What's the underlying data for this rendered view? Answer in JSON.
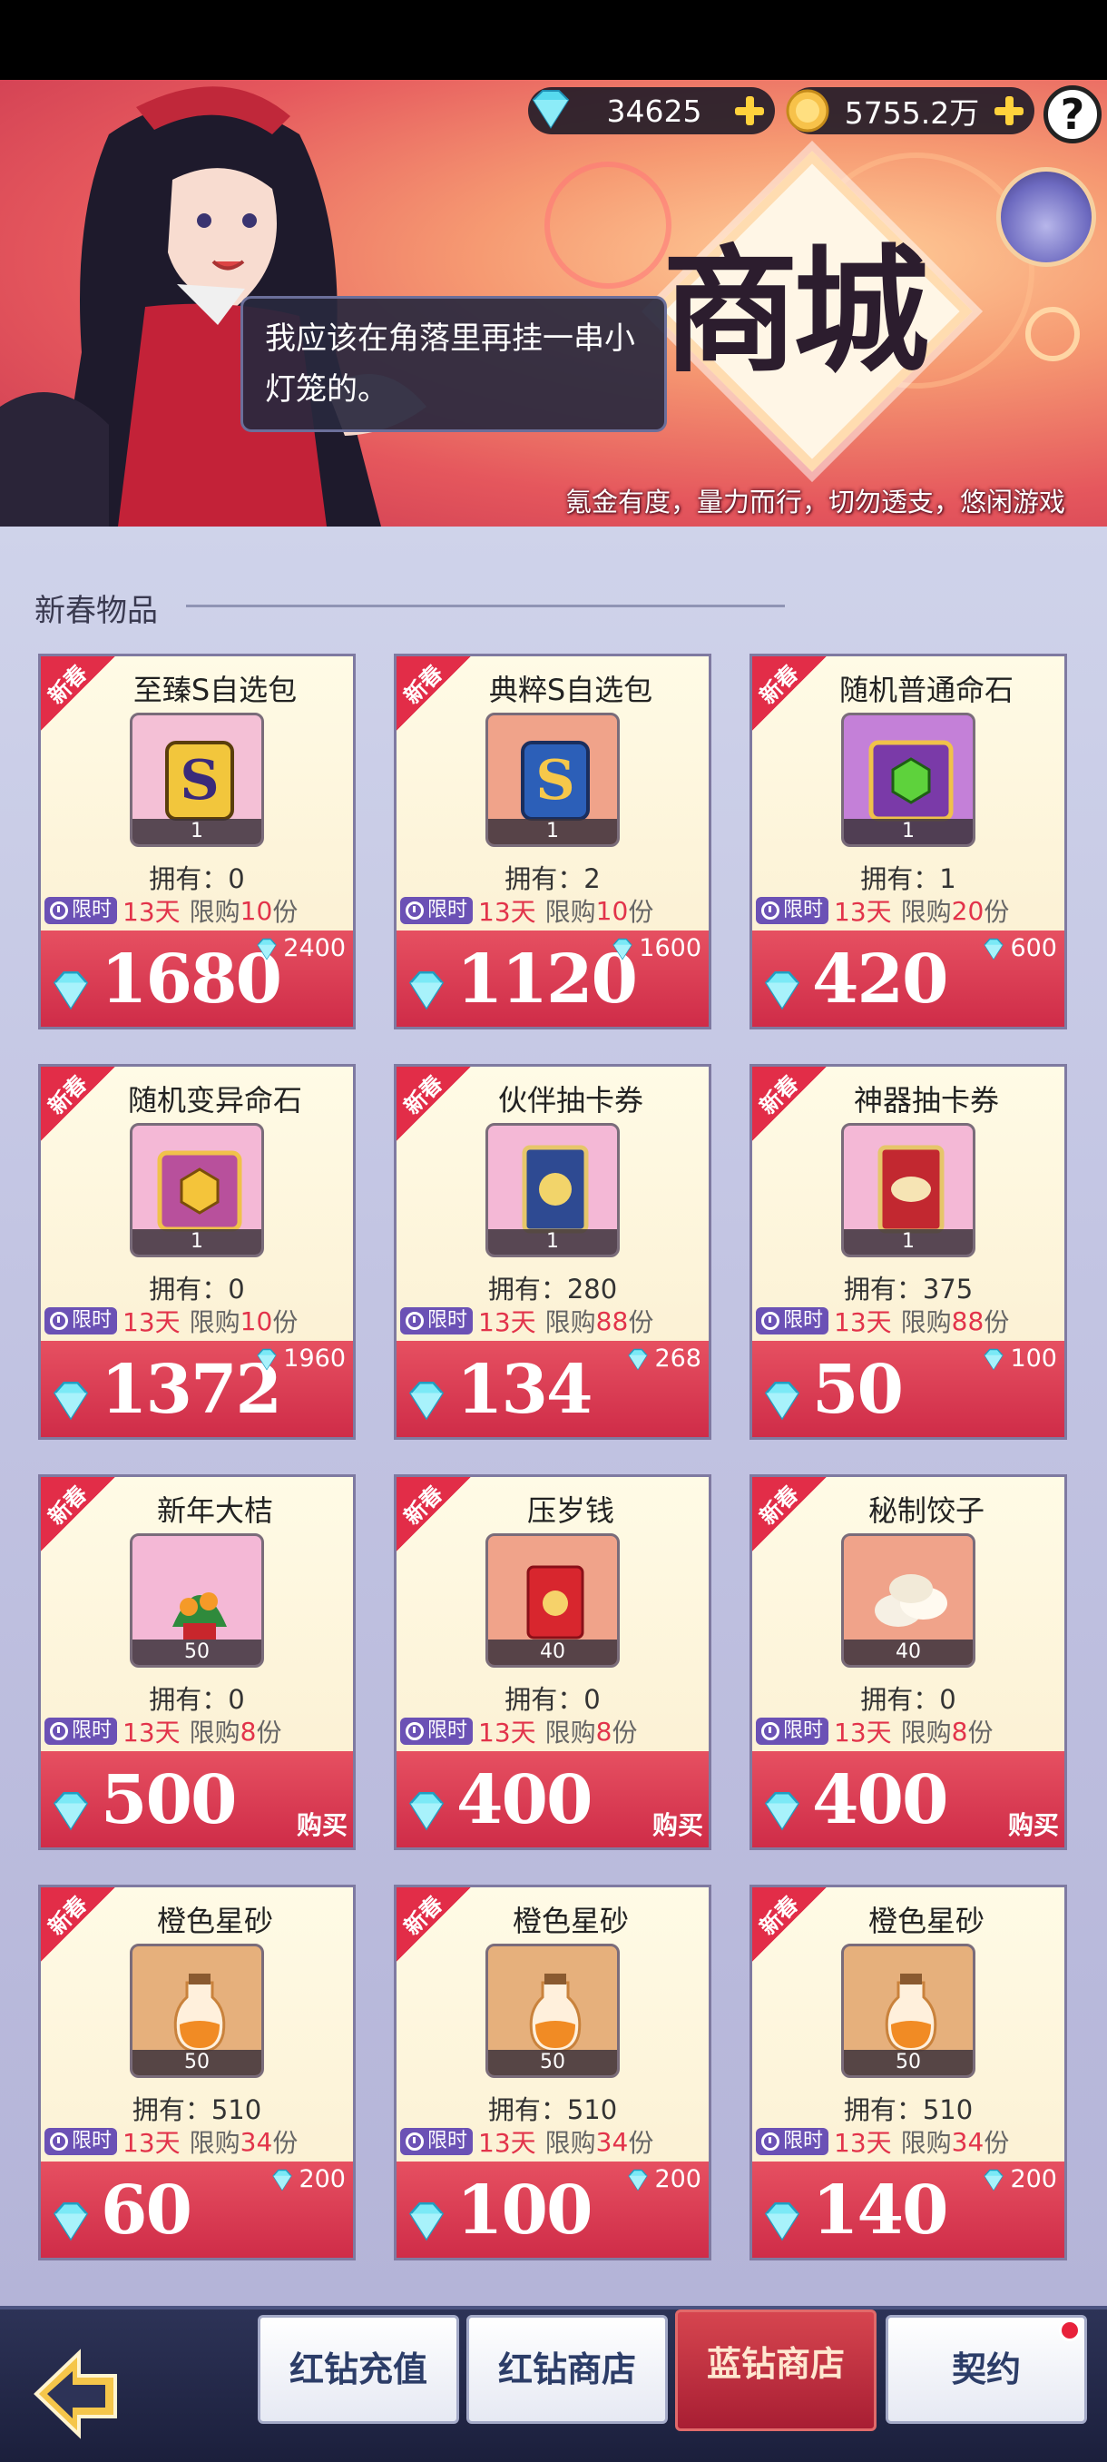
{
  "header": {
    "diamonds": "34625",
    "gold": "5755.2万",
    "help_label": "?",
    "shop_title": "商城",
    "speech": "我应该在角落里再挂一串小灯笼的。",
    "slogan": "氪金有度，量力而行，切勿透支，悠闲游戏"
  },
  "section": {
    "title": "新春物品"
  },
  "ribbon_label": "新春",
  "limited_label": "限时",
  "owned_prefix": "拥有：",
  "limit_prefix": "限购",
  "limit_suffix": "份",
  "items": [
    {
      "name": "至臻S自选包",
      "qty": "1",
      "owned": "0",
      "days": "13天",
      "limit": "10",
      "price": "1680",
      "original": "2400",
      "buy": "",
      "icon": "s-pack-gold-icon",
      "color": "#f4c0d6"
    },
    {
      "name": "典粹S自选包",
      "qty": "1",
      "owned": "2",
      "days": "13天",
      "limit": "10",
      "price": "1120",
      "original": "1600",
      "buy": "",
      "icon": "s-pack-blue-icon",
      "color": "#f0a38a"
    },
    {
      "name": "随机普通命石",
      "qty": "1",
      "owned": "1",
      "days": "13天",
      "limit": "20",
      "price": "420",
      "original": "600",
      "buy": "",
      "icon": "green-stone-chest-icon",
      "color": "#c480d8"
    },
    {
      "name": "随机变异命石",
      "qty": "1",
      "owned": "0",
      "days": "13天",
      "limit": "10",
      "price": "1372",
      "original": "1960",
      "buy": "",
      "icon": "gold-stone-chest-icon",
      "color": "#f4b8d6"
    },
    {
      "name": "伙伴抽卡券",
      "qty": "1",
      "owned": "280",
      "days": "13天",
      "limit": "88",
      "price": "134",
      "original": "268",
      "buy": "",
      "icon": "partner-card-icon",
      "color": "#f4b8d6"
    },
    {
      "name": "神器抽卡券",
      "qty": "1",
      "owned": "375",
      "days": "13天",
      "limit": "88",
      "price": "50",
      "original": "100",
      "buy": "",
      "icon": "artifact-card-icon",
      "color": "#f4b8d6"
    },
    {
      "name": "新年大桔",
      "qty": "50",
      "owned": "0",
      "days": "13天",
      "limit": "8",
      "price": "500",
      "original": "",
      "buy": "购买",
      "icon": "orange-tree-icon",
      "color": "#f4b8d6"
    },
    {
      "name": "压岁钱",
      "qty": "40",
      "owned": "0",
      "days": "13天",
      "limit": "8",
      "price": "400",
      "original": "",
      "buy": "购买",
      "icon": "red-envelope-icon",
      "color": "#f0a38a"
    },
    {
      "name": "秘制饺子",
      "qty": "40",
      "owned": "0",
      "days": "13天",
      "limit": "8",
      "price": "400",
      "original": "",
      "buy": "购买",
      "icon": "dumpling-icon",
      "color": "#f0a38a"
    },
    {
      "name": "橙色星砂",
      "qty": "50",
      "owned": "510",
      "days": "13天",
      "limit": "34",
      "price": "60",
      "original": "200",
      "buy": "",
      "icon": "star-sand-bottle-icon",
      "color": "#e6b07c"
    },
    {
      "name": "橙色星砂",
      "qty": "50",
      "owned": "510",
      "days": "13天",
      "limit": "34",
      "price": "100",
      "original": "200",
      "buy": "",
      "icon": "star-sand-bottle-icon",
      "color": "#e6b07c"
    },
    {
      "name": "橙色星砂",
      "qty": "50",
      "owned": "510",
      "days": "13天",
      "limit": "34",
      "price": "140",
      "original": "200",
      "buy": "",
      "icon": "star-sand-bottle-icon",
      "color": "#e6b07c"
    }
  ],
  "nav": {
    "tabs": [
      "红钻充值",
      "红钻商店",
      "蓝钻商店",
      "契约"
    ],
    "active_tab": "蓝钻商店"
  },
  "colors": {
    "price_red": "#cf2c48",
    "gem_cyan": "#5fe2f2",
    "limited_purple": "#6b51b5",
    "accent_red": "#e2334a"
  }
}
